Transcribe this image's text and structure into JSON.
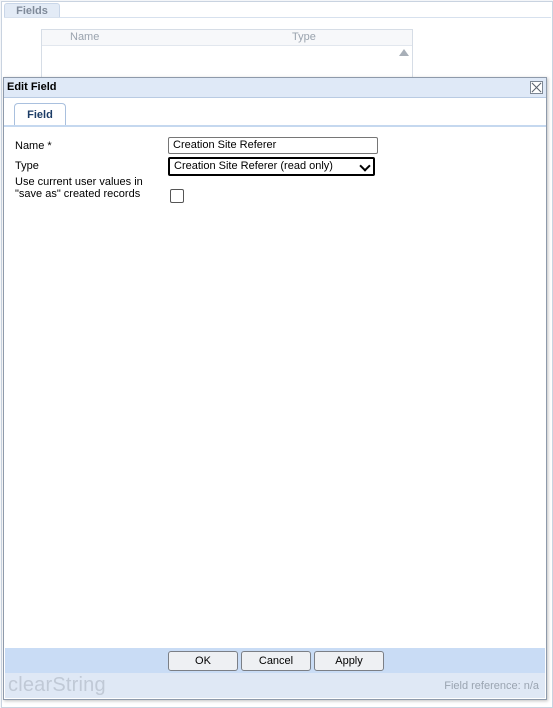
{
  "background": {
    "fields_tab": "Fields",
    "grid_columns": [
      "Name",
      "Type"
    ]
  },
  "dialog": {
    "title": "Edit Field",
    "tab": "Field",
    "form": {
      "name_label": "Name *",
      "name_value": "Creation Site Referer",
      "type_label": "Type",
      "type_value": "Creation Site Referer (read only)",
      "save_as_label_line1": "Use current user values in",
      "save_as_label_line2": "\"save as\" created records",
      "save_as_checked": false
    },
    "buttons": {
      "ok": "OK",
      "cancel": "Cancel",
      "apply": "Apply"
    },
    "footer": {
      "brand": "clearString",
      "field_reference": "Field reference: n/a"
    }
  },
  "colors": {
    "title_bar": "#dfe9f7",
    "button_bar": "#c9dcf5",
    "status_bar": "#dfe8f5"
  }
}
